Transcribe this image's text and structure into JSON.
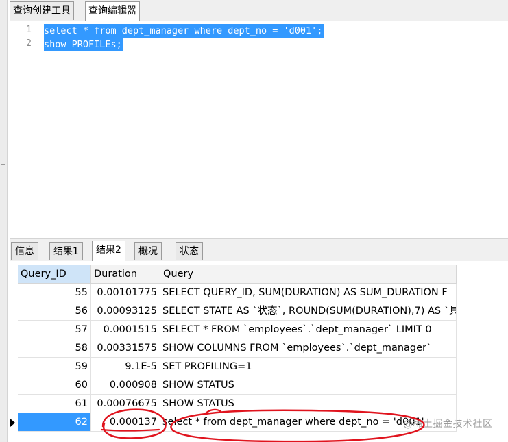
{
  "top_tabs": [
    "查询创建工具",
    "查询编辑器"
  ],
  "editor": {
    "line_numbers": [
      "1",
      "2"
    ],
    "lines": [
      "select * from dept_manager where dept_no = 'd001';",
      "show PROFILEs;"
    ]
  },
  "result_tabs": [
    "信息",
    "结果1",
    "结果2",
    "概况",
    "状态"
  ],
  "grid": {
    "columns": [
      "Query_ID",
      "Duration",
      "Query"
    ],
    "rows": [
      {
        "id": "55",
        "duration": "0.00101775",
        "query": "SELECT QUERY_ID, SUM(DURATION) AS SUM_DURATION F"
      },
      {
        "id": "56",
        "duration": "0.00093125",
        "query": "SELECT STATE AS `状态`, ROUND(SUM(DURATION),7) AS `具"
      },
      {
        "id": "57",
        "duration": "0.0001515",
        "query": "SELECT * FROM `employees`.`dept_manager` LIMIT 0"
      },
      {
        "id": "58",
        "duration": "0.00331575",
        "query": "SHOW COLUMNS FROM `employees`.`dept_manager`"
      },
      {
        "id": "59",
        "duration": "9.1E-5",
        "query": "SET PROFILING=1"
      },
      {
        "id": "60",
        "duration": "0.000908",
        "query": "SHOW STATUS"
      },
      {
        "id": "61",
        "duration": "0.00076675",
        "query": "SHOW STATUS"
      },
      {
        "id": "62",
        "duration": "0.000137",
        "query": "select * from dept_manager where dept_no = 'd001'"
      }
    ]
  },
  "watermark": "@稀土掘金技术社区",
  "colors": {
    "selection": "#3399ff",
    "annotation": "#e0141e"
  }
}
